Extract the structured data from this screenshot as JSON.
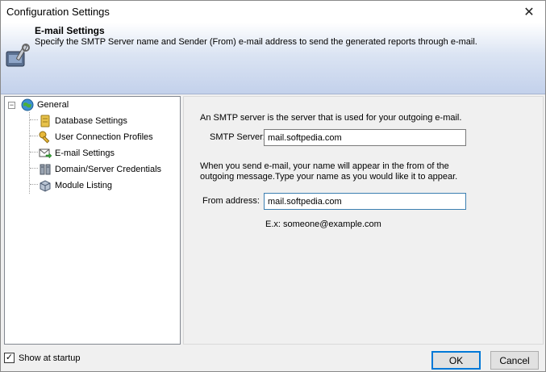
{
  "window": {
    "title": "Configuration Settings",
    "close_glyph": "✕"
  },
  "banner": {
    "heading": "E-mail Settings",
    "description": "Specify the SMTP Server name and Sender (From) e-mail address to send the generated reports through e-mail.",
    "icon": "tools-icon"
  },
  "tree": {
    "expander": "−",
    "root": {
      "label": "General",
      "icon": "globe-icon"
    },
    "items": [
      {
        "label": "Database Settings",
        "icon": "database-icon"
      },
      {
        "label": "User Connection Profiles",
        "icon": "key-icon"
      },
      {
        "label": "E-mail Settings",
        "icon": "email-icon"
      },
      {
        "label": "Domain/Server Credentials",
        "icon": "server-icon"
      },
      {
        "label": "Module Listing",
        "icon": "module-icon"
      }
    ]
  },
  "panel": {
    "smtp_intro": "An SMTP server is the server that is used for your outgoing e-mail.",
    "smtp_label": "SMTP Server:",
    "smtp_value": "mail.softpedia.com",
    "from_intro_line1": "When you send e-mail, your name will appear in the from of the",
    "from_intro_line2": "outgoing message.Type your name as you would like it to appear.",
    "from_label": "From address:",
    "from_value": "mail.softpedia.com",
    "example": "E.x: someone@example.com"
  },
  "footer": {
    "show_at_startup_label": "Show at startup",
    "show_at_startup_checked": true,
    "check_glyph": "✓",
    "ok_label": "OK",
    "cancel_label": "Cancel"
  },
  "colors": {
    "banner_gradient_end": "#c3d1eb",
    "default_button_border": "#0078d7"
  }
}
